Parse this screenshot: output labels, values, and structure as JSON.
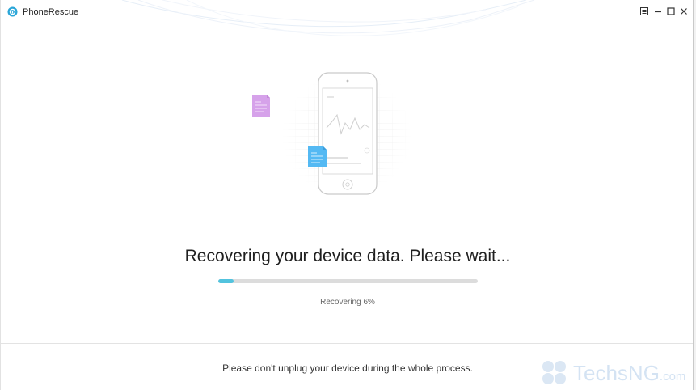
{
  "window": {
    "title": "PhoneRescue",
    "controls": {
      "menu_icon": "menu-icon",
      "minimize_icon": "minimize-icon",
      "maximize_icon": "maximize-icon",
      "close_icon": "close-icon"
    }
  },
  "main": {
    "status_title": "Recovering your device data. Please wait...",
    "progress": {
      "percent": 6,
      "label": "Recovering 6%",
      "fill_color": "#52c3de",
      "track_color": "#dcdcdc"
    }
  },
  "footer": {
    "note": "Please don't unplug your device during the whole process."
  },
  "watermark": {
    "brand": "TechsNG",
    "suffix": ".com"
  },
  "colors": {
    "accent": "#52c3de",
    "file_purple": "#d9a6ea",
    "file_blue": "#5bbcf2"
  }
}
